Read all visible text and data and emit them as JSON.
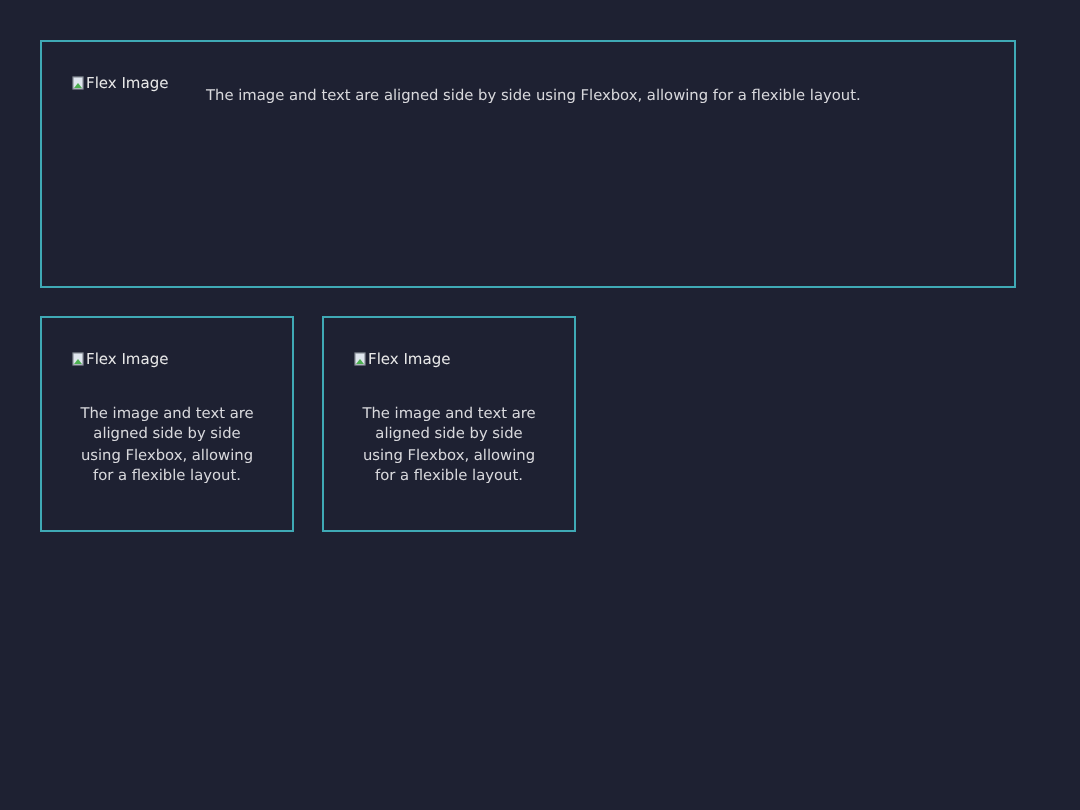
{
  "cards": [
    {
      "kind": "wide",
      "image_alt": "Flex Image",
      "text": "The image and text are aligned side by side using Flexbox, allowing for a flexible layout."
    },
    {
      "kind": "narrow",
      "image_alt": "Flex Image",
      "text": "The image and text are aligned side by side using Flexbox, allowing for a flexible layout."
    },
    {
      "kind": "narrow",
      "image_alt": "Flex Image",
      "text": "The image and text are aligned side by side using Flexbox, allowing for a flexible layout."
    }
  ]
}
